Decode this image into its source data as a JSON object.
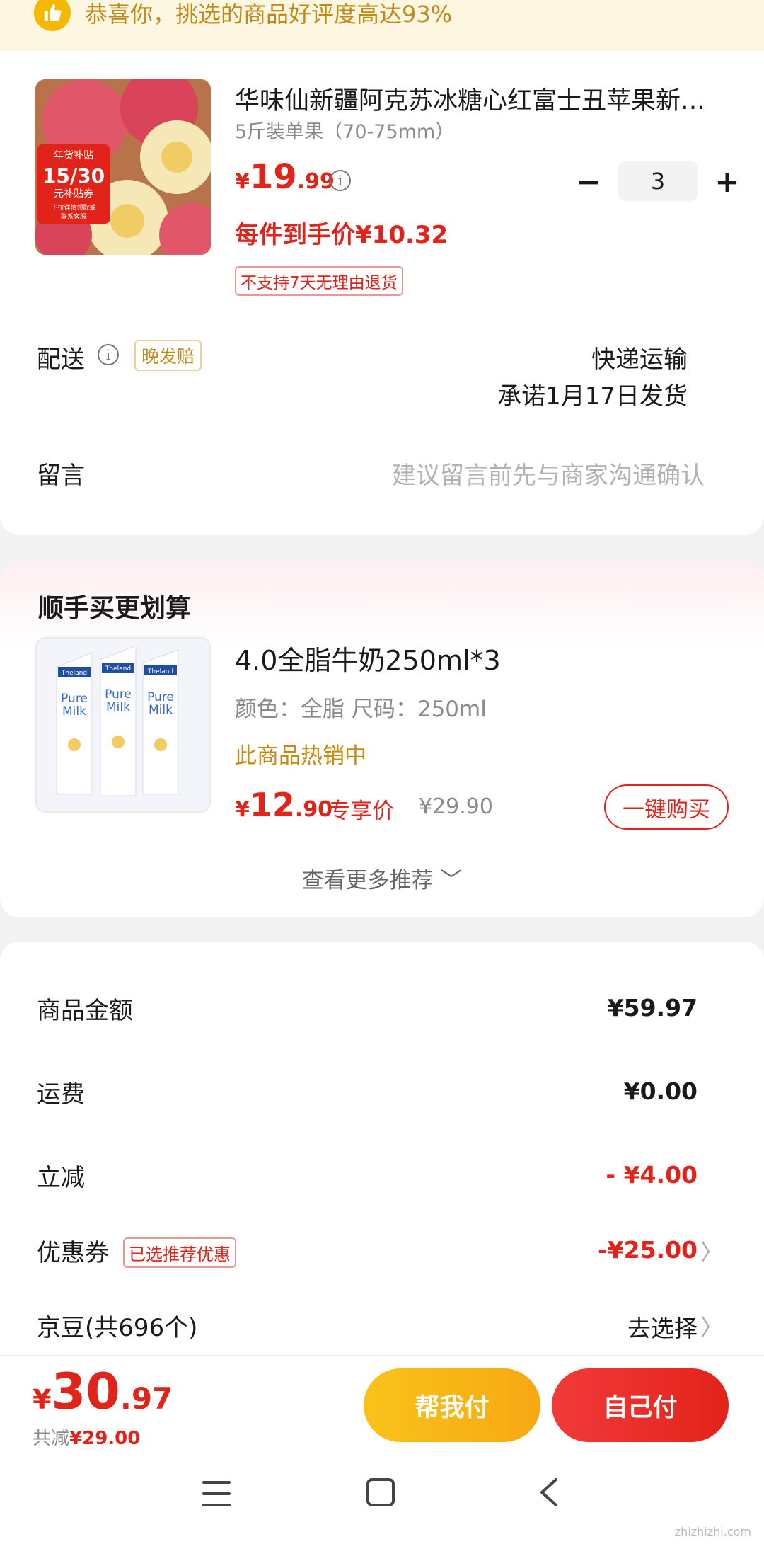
{
  "banner": {
    "text": "恭喜你，挑选的商品好评度高达93%"
  },
  "product1": {
    "title": "华味仙新疆阿克苏冰糖心红富士丑苹果新…",
    "spec": "5斤装单果（70-75mm）",
    "price_currency": "¥",
    "price_int": "19",
    "price_dec": ".99",
    "quantity": "3",
    "unit_price_text": "每件到手价¥10.32",
    "return_tag": "不支持7天无理由退货",
    "image_badge": {
      "line1": "年货补贴",
      "line2": "15/30",
      "line3": "元补贴券",
      "line4": "下拉详情领取或",
      "line5": "联系客服"
    }
  },
  "delivery": {
    "label": "配送",
    "late_badge": "晚发赔",
    "method": "快递运输",
    "promise": "承诺1月17日发货"
  },
  "message": {
    "label": "留言",
    "placeholder": "建议留言前先与商家沟通确认"
  },
  "recommend": {
    "title": "顺手买更划算",
    "product": {
      "title": "4.0全脂牛奶250ml*3",
      "spec": "颜色：全脂   尺码：250ml",
      "hot": "此商品热销中",
      "price_currency": "¥",
      "price_int": "12",
      "price_dec": ".90",
      "exclusive": "专享价",
      "original_price": "¥29.90",
      "buy_label": "一键购买",
      "image_text": {
        "brand": "Theland",
        "name1": "Pure",
        "name2": "Milk"
      }
    },
    "more_label": "查看更多推荐 ﹀"
  },
  "summary": {
    "rows": [
      {
        "label": "商品金额",
        "value": "¥59.97"
      },
      {
        "label": "运费",
        "value": "¥0.00"
      },
      {
        "label": "立减",
        "value": "- ¥4.00"
      },
      {
        "label": "优惠券",
        "badge": "已选推荐优惠",
        "value": "-¥25.00"
      },
      {
        "label": "京豆(共696个)",
        "value": "去选择"
      }
    ]
  },
  "bottom": {
    "total_currency": "¥",
    "total_int": "30",
    "total_dec": ".97",
    "saved_label": "共减",
    "saved_value": "¥29.00",
    "help_pay_label": "帮我付",
    "self_pay_label": "自己付"
  },
  "watermark": "zhizhizhi.com",
  "colors": {
    "accent_red": "#e2231a",
    "gold": "#f7b512",
    "banner_bg": "#fdf7e1"
  }
}
